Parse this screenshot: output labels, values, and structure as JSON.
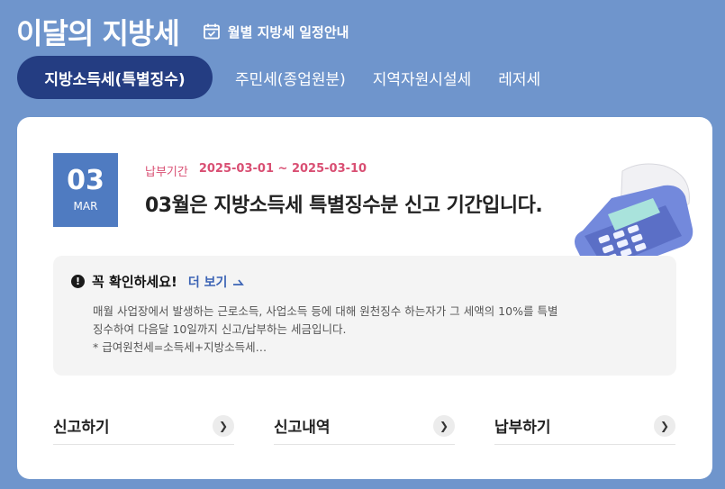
{
  "header": {
    "title": "이달의 지방세",
    "schedule_label": "월별 지방세 일정안내"
  },
  "tabs": [
    {
      "label": "지방소득세(특별징수)",
      "active": true
    },
    {
      "label": "주민세(종업원분)",
      "active": false
    },
    {
      "label": "지역자원시설세",
      "active": false
    },
    {
      "label": "레저세",
      "active": false
    }
  ],
  "date": {
    "day": "03",
    "month": "MAR"
  },
  "period": {
    "label": "납부기간",
    "value": "2025-03-01 ~ 2025-03-10"
  },
  "headline": "03월은 지방소득세 특별징수분 신고 기간입니다.",
  "notice": {
    "title": "꼭 확인하세요!",
    "more_label": "더 보기",
    "line1": "매월 사업장에서 발생하는 근로소득, 사업소득 등에 대해 원천징수 하는자가 그 세액의 10%를 특별",
    "line2": "징수하여 다음달 10일까지 신고/납부하는 세금입니다.",
    "line3": "* 급여원천세=소득세+지방소득세…"
  },
  "actions": [
    {
      "label": "신고하기"
    },
    {
      "label": "신고내역"
    },
    {
      "label": "납부하기"
    }
  ],
  "colors": {
    "background": "#6f95cc",
    "active_tab": "#243d82",
    "date_box": "#4f7bc1",
    "period_text": "#d94f73",
    "link": "#3c64b5"
  }
}
